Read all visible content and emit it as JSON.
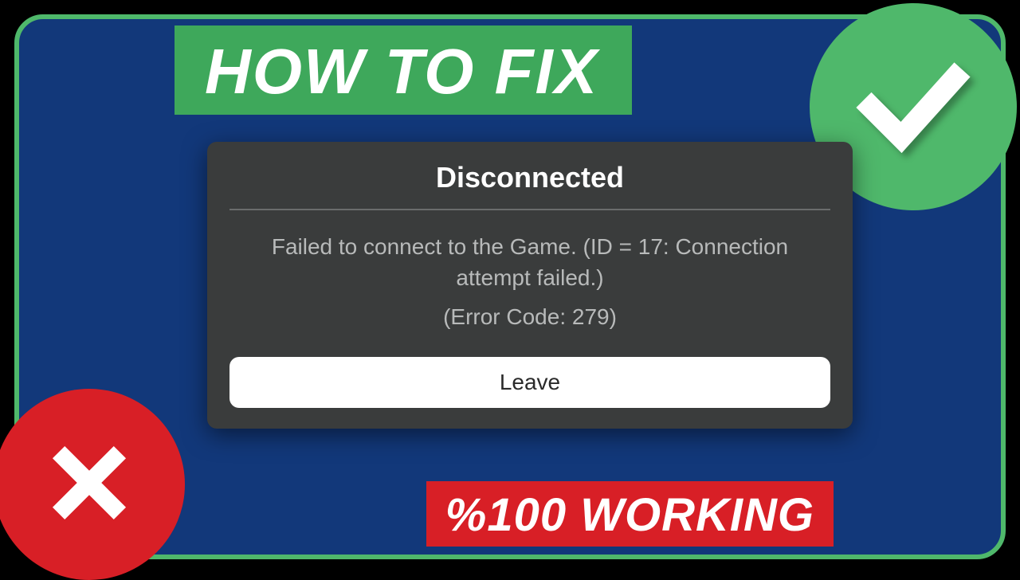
{
  "banners": {
    "title": "HOW TO FIX",
    "working": "%100 WORKING"
  },
  "dialog": {
    "title": "Disconnected",
    "message": "Failed to connect to the Game. (ID = 17: Connection attempt failed.)",
    "error": "(Error Code: 279)",
    "leave_label": "Leave"
  },
  "icons": {
    "check": "checkmark-icon",
    "cross": "cross-icon"
  },
  "colors": {
    "frame_border": "#4fb86b",
    "frame_bg": "#12387a",
    "green": "#3ea85b",
    "red": "#d81f26",
    "dialog_bg": "#3a3c3c"
  }
}
